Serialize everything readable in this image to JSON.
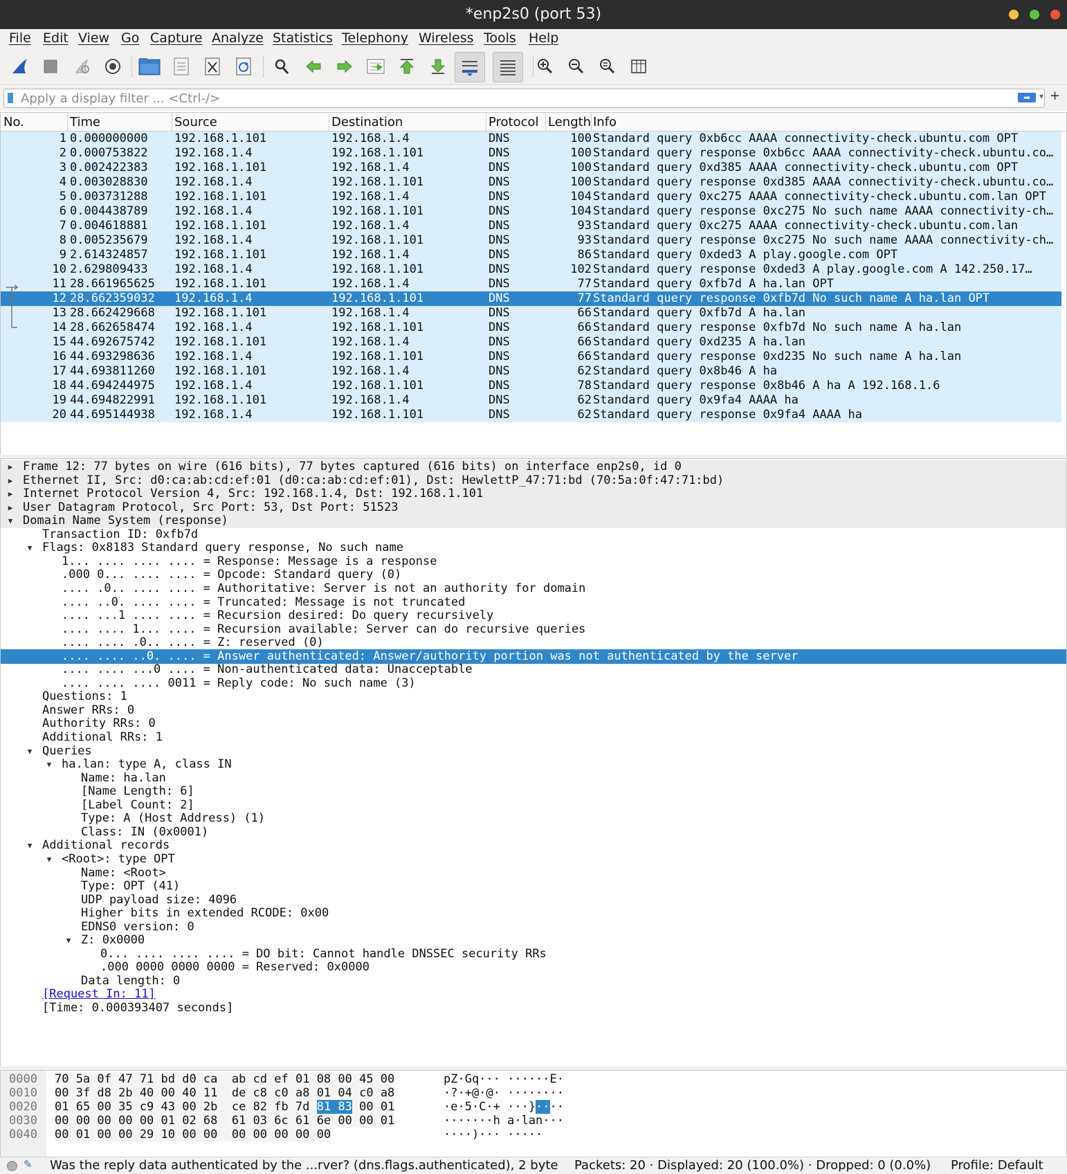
{
  "window": {
    "title": "*enp2s0 (port 53)",
    "buttons": [
      "minimize",
      "maximize",
      "close"
    ]
  },
  "menu": [
    "File",
    "Edit",
    "View",
    "Go",
    "Capture",
    "Analyze",
    "Statistics",
    "Telephony",
    "Wireless",
    "Tools",
    "Help"
  ],
  "toolbar": [
    {
      "name": "start-capture-icon",
      "color": "#2a5db0"
    },
    {
      "name": "stop-capture-icon",
      "color": "#8f8f8f"
    },
    {
      "name": "restart-capture-icon",
      "color": "#9a9a9a"
    },
    {
      "name": "capture-options-icon",
      "color": "#444444"
    },
    {
      "name": "open-file-icon",
      "color": "#3f7fc8"
    },
    {
      "name": "save-file-icon",
      "color": "#7a7a7a"
    },
    {
      "name": "close-file-icon",
      "color": "#555555"
    },
    {
      "name": "reload-file-icon",
      "color": "#2a6fc0"
    },
    {
      "name": "find-packet-icon",
      "color": "#333333"
    },
    {
      "name": "go-back-icon",
      "color": "#4aa53a"
    },
    {
      "name": "go-forward-icon",
      "color": "#4aa53a"
    },
    {
      "name": "go-to-packet-icon",
      "color": "#4aa53a"
    },
    {
      "name": "go-first-icon",
      "color": "#4aa53a"
    },
    {
      "name": "go-last-icon",
      "color": "#4aa53a"
    },
    {
      "name": "auto-scroll-icon",
      "color": "#2a5db0"
    },
    {
      "name": "colorize-icon",
      "color": "#555555"
    },
    {
      "name": "zoom-in-icon",
      "color": "#333333"
    },
    {
      "name": "zoom-out-icon",
      "color": "#333333"
    },
    {
      "name": "normal-size-icon",
      "color": "#333333"
    },
    {
      "name": "resize-columns-icon",
      "color": "#333333"
    }
  ],
  "filter": {
    "placeholder": "Apply a display filter ... <Ctrl-/>",
    "value": "",
    "plus": "+"
  },
  "packet_list": {
    "columns": [
      "No.",
      "Time",
      "Source",
      "Destination",
      "Protocol",
      "Length",
      "Info"
    ],
    "selected_no": 12,
    "row_color": "#dbeefc",
    "selected_color": "#2f86c9",
    "rows": [
      {
        "no": "1",
        "time": "0.000000000",
        "src": "192.168.1.101",
        "dst": "192.168.1.4",
        "proto": "DNS",
        "len": "100",
        "info": "Standard query 0xb6cc AAAA connectivity-check.ubuntu.com OPT"
      },
      {
        "no": "2",
        "time": "0.000753822",
        "src": "192.168.1.4",
        "dst": "192.168.1.101",
        "proto": "DNS",
        "len": "100",
        "info": "Standard query response 0xb6cc AAAA connectivity-check.ubuntu.com OPT"
      },
      {
        "no": "3",
        "time": "0.002422383",
        "src": "192.168.1.101",
        "dst": "192.168.1.4",
        "proto": "DNS",
        "len": "100",
        "info": "Standard query 0xd385 AAAA connectivity-check.ubuntu.com OPT"
      },
      {
        "no": "4",
        "time": "0.003028830",
        "src": "192.168.1.4",
        "dst": "192.168.1.101",
        "proto": "DNS",
        "len": "100",
        "info": "Standard query response 0xd385 AAAA connectivity-check.ubuntu.com OPT"
      },
      {
        "no": "5",
        "time": "0.003731288",
        "src": "192.168.1.101",
        "dst": "192.168.1.4",
        "proto": "DNS",
        "len": "104",
        "info": "Standard query 0xc275 AAAA connectivity-check.ubuntu.com.lan OPT"
      },
      {
        "no": "6",
        "time": "0.004438789",
        "src": "192.168.1.4",
        "dst": "192.168.1.101",
        "proto": "DNS",
        "len": "104",
        "info": "Standard query response 0xc275 No such name AAAA connectivity-check.ubuntu.com.lan OPT"
      },
      {
        "no": "7",
        "time": "0.004618881",
        "src": "192.168.1.101",
        "dst": "192.168.1.4",
        "proto": "DNS",
        "len": "93",
        "info": "Standard query 0xc275 AAAA connectivity-check.ubuntu.com.lan"
      },
      {
        "no": "8",
        "time": "0.005235679",
        "src": "192.168.1.4",
        "dst": "192.168.1.101",
        "proto": "DNS",
        "len": "93",
        "info": "Standard query response 0xc275 No such name AAAA connectivity-check.ubuntu.com.lan"
      },
      {
        "no": "9",
        "time": "2.614324857",
        "src": "192.168.1.101",
        "dst": "192.168.1.4",
        "proto": "DNS",
        "len": "86",
        "info": "Standard query 0xded3 A play.google.com OPT"
      },
      {
        "no": "10",
        "time": "2.629809433",
        "src": "192.168.1.4",
        "dst": "192.168.1.101",
        "proto": "DNS",
        "len": "102",
        "info": "Standard query response 0xded3 A play.google.com A 142.250.17…"
      },
      {
        "no": "11",
        "time": "28.661965625",
        "src": "192.168.1.101",
        "dst": "192.168.1.4",
        "proto": "DNS",
        "len": "77",
        "info": "Standard query 0xfb7d A ha.lan OPT"
      },
      {
        "no": "12",
        "time": "28.662359032",
        "src": "192.168.1.4",
        "dst": "192.168.1.101",
        "proto": "DNS",
        "len": "77",
        "info": "Standard query response 0xfb7d No such name A ha.lan OPT"
      },
      {
        "no": "13",
        "time": "28.662429668",
        "src": "192.168.1.101",
        "dst": "192.168.1.4",
        "proto": "DNS",
        "len": "66",
        "info": "Standard query 0xfb7d A ha.lan"
      },
      {
        "no": "14",
        "time": "28.662658474",
        "src": "192.168.1.4",
        "dst": "192.168.1.101",
        "proto": "DNS",
        "len": "66",
        "info": "Standard query response 0xfb7d No such name A ha.lan"
      },
      {
        "no": "15",
        "time": "44.692675742",
        "src": "192.168.1.101",
        "dst": "192.168.1.4",
        "proto": "DNS",
        "len": "66",
        "info": "Standard query 0xd235 A ha.lan"
      },
      {
        "no": "16",
        "time": "44.693298636",
        "src": "192.168.1.4",
        "dst": "192.168.1.101",
        "proto": "DNS",
        "len": "66",
        "info": "Standard query response 0xd235 No such name A ha.lan"
      },
      {
        "no": "17",
        "time": "44.693811260",
        "src": "192.168.1.101",
        "dst": "192.168.1.4",
        "proto": "DNS",
        "len": "62",
        "info": "Standard query 0x8b46 A ha"
      },
      {
        "no": "18",
        "time": "44.694244975",
        "src": "192.168.1.4",
        "dst": "192.168.1.101",
        "proto": "DNS",
        "len": "78",
        "info": "Standard query response 0x8b46 A ha A 192.168.1.6"
      },
      {
        "no": "19",
        "time": "44.694822991",
        "src": "192.168.1.101",
        "dst": "192.168.1.4",
        "proto": "DNS",
        "len": "62",
        "info": "Standard query 0x9fa4 AAAA ha"
      },
      {
        "no": "20",
        "time": "44.695144938",
        "src": "192.168.1.4",
        "dst": "192.168.1.101",
        "proto": "DNS",
        "len": "62",
        "info": "Standard query response 0x9fa4 AAAA ha"
      }
    ]
  },
  "details": {
    "selected_index": 14,
    "rows": [
      {
        "level": 0,
        "arrow": "collapsed",
        "text": "Frame 12: 77 bytes on wire (616 bits), 77 bytes captured (616 bits) on interface enp2s0, id 0"
      },
      {
        "level": 0,
        "arrow": "collapsed",
        "text": "Ethernet II, Src: d0:ca:ab:cd:ef:01 (d0:ca:ab:cd:ef:01), Dst: HewlettP_47:71:bd (70:5a:0f:47:71:bd)"
      },
      {
        "level": 0,
        "arrow": "collapsed",
        "text": "Internet Protocol Version 4, Src: 192.168.1.4, Dst: 192.168.1.101"
      },
      {
        "level": 0,
        "arrow": "collapsed",
        "text": "User Datagram Protocol, Src Port: 53, Dst Port: 51523"
      },
      {
        "level": 0,
        "arrow": "expanded",
        "text": "Domain Name System (response)"
      },
      {
        "level": 1,
        "arrow": "none",
        "text": "Transaction ID: 0xfb7d"
      },
      {
        "level": 1,
        "arrow": "expanded",
        "text": "Flags: 0x8183 Standard query response, No such name"
      },
      {
        "level": 2,
        "arrow": "none",
        "text": "1... .... .... .... = Response: Message is a response"
      },
      {
        "level": 2,
        "arrow": "none",
        "text": ".000 0... .... .... = Opcode: Standard query (0)"
      },
      {
        "level": 2,
        "arrow": "none",
        "text": ".... .0.. .... .... = Authoritative: Server is not an authority for domain"
      },
      {
        "level": 2,
        "arrow": "none",
        "text": ".... ..0. .... .... = Truncated: Message is not truncated"
      },
      {
        "level": 2,
        "arrow": "none",
        "text": ".... ...1 .... .... = Recursion desired: Do query recursively"
      },
      {
        "level": 2,
        "arrow": "none",
        "text": ".... .... 1... .... = Recursion available: Server can do recursive queries"
      },
      {
        "level": 2,
        "arrow": "none",
        "text": ".... .... .0.. .... = Z: reserved (0)"
      },
      {
        "level": 2,
        "arrow": "none",
        "text": ".... .... ..0. .... = Answer authenticated: Answer/authority portion was not authenticated by the server"
      },
      {
        "level": 2,
        "arrow": "none",
        "text": ".... .... ...0 .... = Non-authenticated data: Unacceptable"
      },
      {
        "level": 2,
        "arrow": "none",
        "text": ".... .... .... 0011 = Reply code: No such name (3)"
      },
      {
        "level": 1,
        "arrow": "none",
        "text": "Questions: 1"
      },
      {
        "level": 1,
        "arrow": "none",
        "text": "Answer RRs: 0"
      },
      {
        "level": 1,
        "arrow": "none",
        "text": "Authority RRs: 0"
      },
      {
        "level": 1,
        "arrow": "none",
        "text": "Additional RRs: 1"
      },
      {
        "level": 1,
        "arrow": "expanded",
        "text": "Queries"
      },
      {
        "level": 2,
        "arrow": "expanded",
        "text": "ha.lan: type A, class IN"
      },
      {
        "level": 3,
        "arrow": "none",
        "text": "Name: ha.lan"
      },
      {
        "level": 3,
        "arrow": "none",
        "text": "[Name Length: 6]"
      },
      {
        "level": 3,
        "arrow": "none",
        "text": "[Label Count: 2]"
      },
      {
        "level": 3,
        "arrow": "none",
        "text": "Type: A (Host Address) (1)"
      },
      {
        "level": 3,
        "arrow": "none",
        "text": "Class: IN (0x0001)"
      },
      {
        "level": 1,
        "arrow": "expanded",
        "text": "Additional records"
      },
      {
        "level": 2,
        "arrow": "expanded",
        "text": "<Root>: type OPT"
      },
      {
        "level": 3,
        "arrow": "none",
        "text": "Name: <Root>"
      },
      {
        "level": 3,
        "arrow": "none",
        "text": "Type: OPT (41)"
      },
      {
        "level": 3,
        "arrow": "none",
        "text": "UDP payload size: 4096"
      },
      {
        "level": 3,
        "arrow": "none",
        "text": "Higher bits in extended RCODE: 0x00"
      },
      {
        "level": 3,
        "arrow": "none",
        "text": "EDNS0 version: 0"
      },
      {
        "level": 3,
        "arrow": "expanded",
        "text": "Z: 0x0000"
      },
      {
        "level": 4,
        "arrow": "none",
        "text": "0... .... .... .... = DO bit: Cannot handle DNSSEC security RRs"
      },
      {
        "level": 4,
        "arrow": "none",
        "text": ".000 0000 0000 0000 = Reserved: 0x0000"
      },
      {
        "level": 3,
        "arrow": "none",
        "text": "Data length: 0"
      },
      {
        "level": 1,
        "arrow": "none",
        "text": "[Request In: 11]",
        "link": true
      },
      {
        "level": 1,
        "arrow": "none",
        "text": "[Time: 0.000393407 seconds]"
      }
    ]
  },
  "hex": {
    "rows": [
      {
        "off": "0000",
        "hex": "70 5a 0f 47 71 bd d0 ca  ab cd ef 01 08 00 45 00",
        "ascii": "pZ·Gq··· ······E·",
        "hl_hex": null,
        "hl_ascii": null
      },
      {
        "off": "0010",
        "hex": "00 3f d8 2b 40 00 40 11  de c8 c0 a8 01 04 c0 a8",
        "ascii": "·?·+@·@· ········",
        "hl_hex": null,
        "hl_ascii": null
      },
      {
        "off": "0020",
        "hex": "01 65 00 35 c9 43 00 2b  ce 82 fb 7d 81 83 00 01",
        "ascii": "·e·5·C·+ ···}····",
        "hl_hex": [
          37,
          42
        ],
        "hl_ascii": [
          13,
          15
        ]
      },
      {
        "off": "0030",
        "hex": "00 00 00 00 00 01 02 68  61 03 6c 61 6e 00 00 01",
        "ascii": "·······h a·lan···",
        "hl_hex": null,
        "hl_ascii": null
      },
      {
        "off": "0040",
        "hex": "00 01 00 00 29 10 00 00  00 00 00 00 00",
        "ascii": "····)··· ·····",
        "hl_hex": null,
        "hl_ascii": null
      }
    ]
  },
  "status": {
    "field_text": "Was the reply data authenticated by the ...rver? (dns.flags.authenticated), 2 byte",
    "packets_text": "Packets: 20 · Displayed: 20 (100.0%) · Dropped: 0 (0.0%)",
    "profile_text": "Profile: Default"
  }
}
